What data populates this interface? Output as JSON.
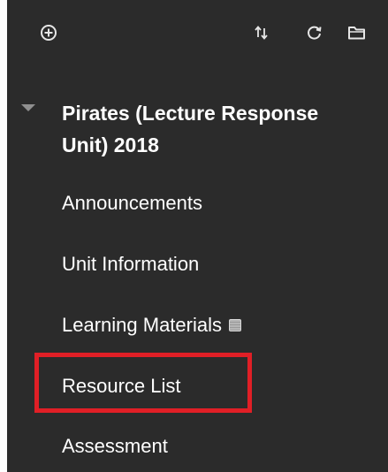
{
  "toolbar": {
    "icons": [
      "add-circle-icon",
      "sort-arrows-icon",
      "refresh-icon",
      "folder-icon"
    ]
  },
  "course": {
    "title": "Pirates (Lecture Response Unit) 2018"
  },
  "menu": {
    "items": [
      {
        "label": "Announcements"
      },
      {
        "label": "Unit Information"
      },
      {
        "label": "Learning Materials",
        "hidden_indicator": true
      },
      {
        "label": "Resource List",
        "highlighted": true
      },
      {
        "label": "Assessment"
      }
    ]
  },
  "colors": {
    "panel_bg": "#2b2b2b",
    "text": "#ffffff",
    "highlight": "#e01f26",
    "caret": "#8f8f8f"
  }
}
